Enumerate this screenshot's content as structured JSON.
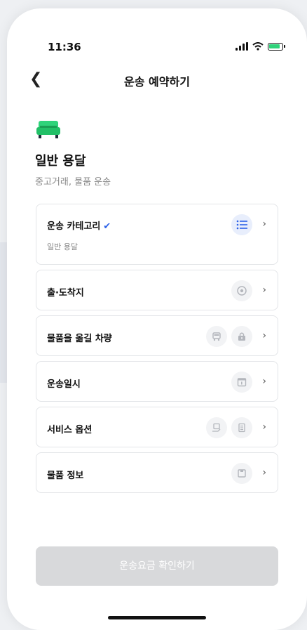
{
  "status_bar": {
    "time": "11:36"
  },
  "header": {
    "title": "운송 예약하기"
  },
  "category": {
    "name": "일반 용달",
    "description": "중고거래, 물품 운송"
  },
  "cards": [
    {
      "label": "운송 카테고리",
      "sub": "일반 용달",
      "checked": true,
      "icons": [
        "list-icon"
      ]
    },
    {
      "label": "출·도착지",
      "icons": [
        "location-pin-icon"
      ]
    },
    {
      "label": "물품을 옮길 차량",
      "icons": [
        "truck-icon",
        "lock-icon"
      ]
    },
    {
      "label": "운송일시",
      "icons": [
        "calendar-icon"
      ]
    },
    {
      "label": "서비스 옵션",
      "icons": [
        "package-hand-icon",
        "document-icon"
      ]
    },
    {
      "label": "물품 정보",
      "icons": [
        "box-icon"
      ]
    }
  ],
  "cta": {
    "label": "운송요금 확인하기",
    "disabled": true
  },
  "colors": {
    "accent": "#2e63e8",
    "category_icon": "#2fd37a",
    "cta_disabled": "#d8d9db"
  }
}
